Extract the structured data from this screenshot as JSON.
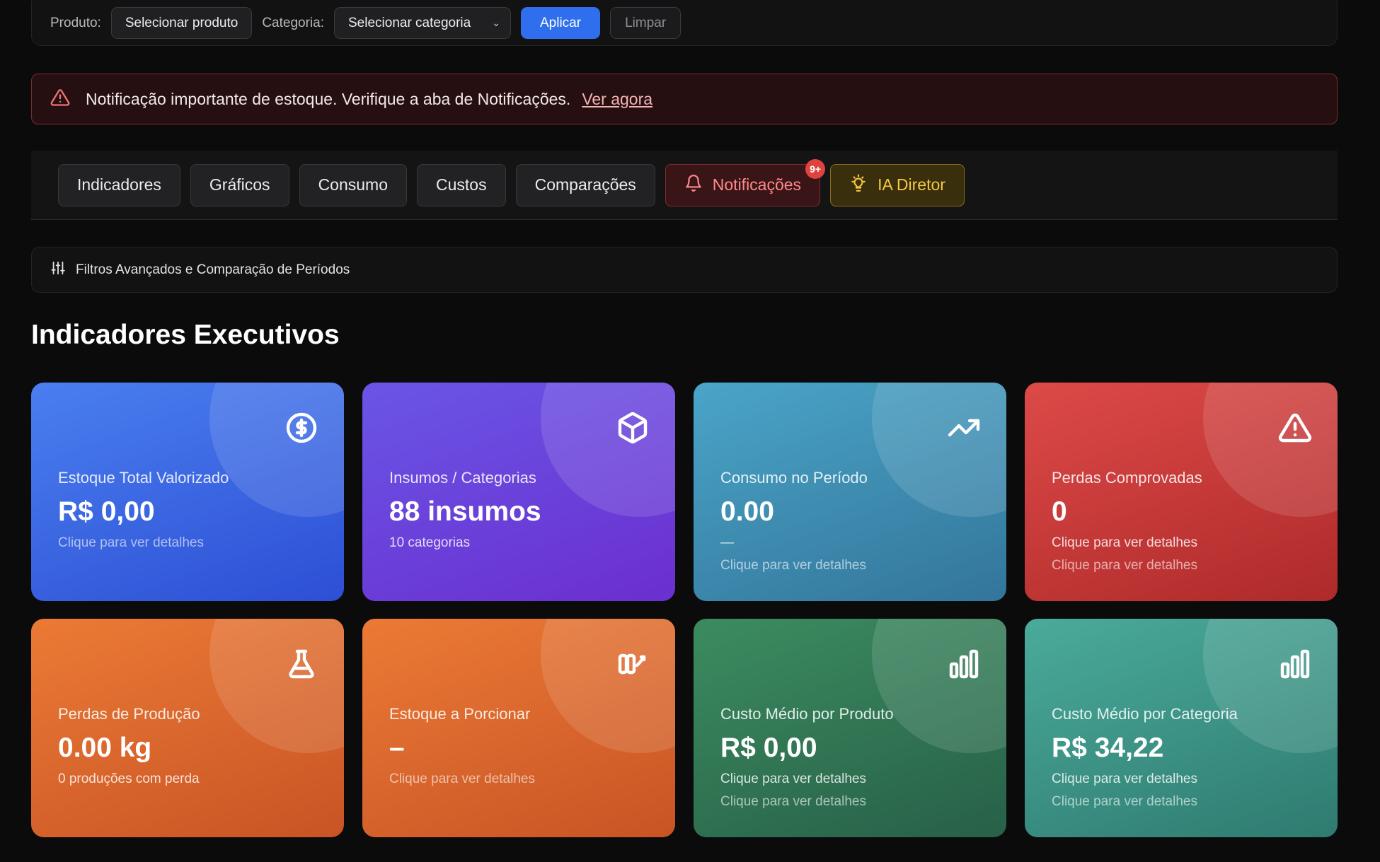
{
  "filterbar": {
    "product_label": "Produto:",
    "product_button": "Selecionar produto",
    "category_label": "Categoria:",
    "category_select": "Selecionar categoria",
    "apply": "Aplicar",
    "clear": "Limpar"
  },
  "alert": {
    "text": "Notificação importante de estoque. Verifique a aba de Notificações.",
    "link": "Ver agora"
  },
  "tabs": [
    {
      "label": "Indicadores"
    },
    {
      "label": "Gráficos"
    },
    {
      "label": "Consumo"
    },
    {
      "label": "Custos"
    },
    {
      "label": "Comparações"
    },
    {
      "label": "Notificações",
      "badge": "9+"
    },
    {
      "label": "IA Diretor"
    }
  ],
  "advanced_filters": "Filtros Avançados e Comparação de Períodos",
  "section_title": "Indicadores Executivos",
  "cards": [
    {
      "title": "Estoque Total Valorizado",
      "value": "R$ 0,00",
      "sub1": "Clique para ver detalhes",
      "sub2": "",
      "icon": "dollar-circle-icon",
      "color": "#3a67e8"
    },
    {
      "title": "Insumos / Categorias",
      "value": "88 insumos",
      "sub1": "10 categorias",
      "sub2": "",
      "icon": "box-icon",
      "color": "#6b45e0"
    },
    {
      "title": "Consumo no Período",
      "value": "0.00",
      "sub1": "—",
      "sub2": "Clique para ver detalhes",
      "icon": "trending-up-icon",
      "color": "#3f95b5"
    },
    {
      "title": "Perdas Comprovadas",
      "value": "0",
      "sub1": "Clique para ver detalhes",
      "sub2": "Clique para ver detalhes",
      "icon": "warning-triangle-icon",
      "color": "#cf3b3b"
    },
    {
      "title": "Perdas de Produção",
      "value": "0.00 kg",
      "sub1": "0 produções com perda",
      "sub2": "",
      "icon": "flask-icon",
      "color": "#e06a2d"
    },
    {
      "title": "Estoque a Porcionar",
      "value": "–",
      "sub1": "Clique para ver detalhes",
      "sub2": "",
      "icon": "portion-icon",
      "color": "#e06a2d"
    },
    {
      "title": "Custo Médio por Produto",
      "value": "R$ 0,00",
      "sub1": "Clique para ver detalhes",
      "sub2": "Clique para ver detalhes",
      "icon": "bar-chart-icon",
      "color": "#2f7d55"
    },
    {
      "title": "Custo Médio por Categoria",
      "value": "R$ 34,22",
      "sub1": "Clique para ver detalhes",
      "sub2": "Clique para ver detalhes",
      "icon": "bar-chart-icon",
      "color": "#3c9988"
    }
  ]
}
